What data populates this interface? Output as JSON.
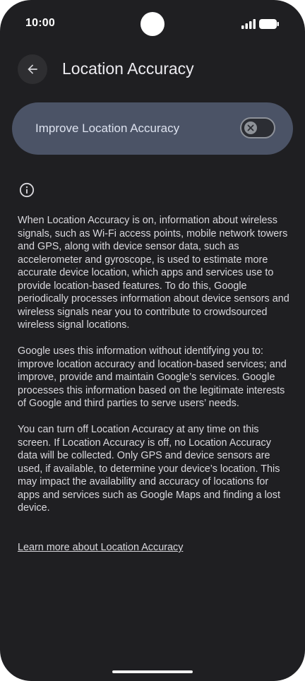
{
  "status_bar": {
    "time": "10:00",
    "signal_icon": "cellular-signal-icon",
    "battery_icon": "battery-full-icon"
  },
  "app_bar": {
    "back_icon": "arrow-back-icon",
    "title": "Location Accuracy"
  },
  "main_toggle": {
    "label": "Improve Location Accuracy",
    "checked": false,
    "thumb_icon": "close-icon"
  },
  "info": {
    "icon": "info-icon"
  },
  "description": {
    "paragraphs": [
      "When Location Accuracy is on, information about wireless signals, such as Wi‑Fi access points, mobile network towers and GPS, along with device sensor data, such as accelerometer and gyroscope, is used to estimate more accurate device location, which apps and services use to provide location‑based features. To do this, Google periodically processes information about device sensors and wireless signals near you to contribute to crowdsourced wireless signal locations.",
      "Google uses this information without identifying you to: improve location accuracy and location‑based services; and improve, provide and maintain Google’s services. Google processes this information based on the legitimate interests of Google and third parties to serve users’ needs.",
      "You can turn off Location Accuracy at any time on this screen. If Location Accuracy is off, no Location Accuracy data will be collected. Only GPS and device sensors are used, if available, to determine your device’s location. This may impact the availability and accuracy of locations for apps and services such as Google Maps and finding a lost device."
    ],
    "learn_more_link": "Learn more about Location Accuracy"
  },
  "colors": {
    "background": "#1f1f22",
    "card": "#4b5366",
    "text": "#d9d8dd"
  }
}
